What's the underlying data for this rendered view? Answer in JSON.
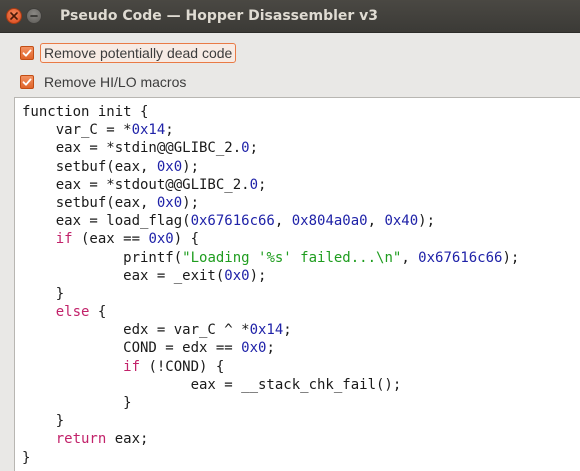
{
  "window": {
    "title": "Pseudo Code — Hopper Disassembler v3",
    "close_icon": "close-icon",
    "minimize_icon": "minimize-icon"
  },
  "options": [
    {
      "label": "Remove potentially dead code",
      "checked": true,
      "focused": true
    },
    {
      "label": "Remove HI/LO macros",
      "checked": true,
      "focused": false
    }
  ],
  "colors": {
    "accent": "#e0642a",
    "keyword": "#c2226a",
    "number": "#1f22a8",
    "string": "#1f9d1f",
    "titlebar": "#3c3b37"
  },
  "code": {
    "lines": [
      [
        {
          "t": "function init {",
          "c": "plain"
        }
      ],
      [
        {
          "t": "    var_C = *",
          "c": "plain"
        },
        {
          "t": "0x14",
          "c": "num"
        },
        {
          "t": ";",
          "c": "plain"
        }
      ],
      [
        {
          "t": "    eax = *stdin@@GLIBC_2.",
          "c": "plain"
        },
        {
          "t": "0",
          "c": "num"
        },
        {
          "t": ";",
          "c": "plain"
        }
      ],
      [
        {
          "t": "    setbuf(eax, ",
          "c": "plain"
        },
        {
          "t": "0x0",
          "c": "num"
        },
        {
          "t": ");",
          "c": "plain"
        }
      ],
      [
        {
          "t": "    eax = *stdout@@GLIBC_2.",
          "c": "plain"
        },
        {
          "t": "0",
          "c": "num"
        },
        {
          "t": ";",
          "c": "plain"
        }
      ],
      [
        {
          "t": "    setbuf(eax, ",
          "c": "plain"
        },
        {
          "t": "0x0",
          "c": "num"
        },
        {
          "t": ");",
          "c": "plain"
        }
      ],
      [
        {
          "t": "    eax = load_flag(",
          "c": "plain"
        },
        {
          "t": "0x67616c66",
          "c": "num"
        },
        {
          "t": ", ",
          "c": "plain"
        },
        {
          "t": "0x804a0a0",
          "c": "num"
        },
        {
          "t": ", ",
          "c": "plain"
        },
        {
          "t": "0x40",
          "c": "num"
        },
        {
          "t": ");",
          "c": "plain"
        }
      ],
      [
        {
          "t": "    ",
          "c": "plain"
        },
        {
          "t": "if",
          "c": "kw"
        },
        {
          "t": " (eax == ",
          "c": "plain"
        },
        {
          "t": "0x0",
          "c": "num"
        },
        {
          "t": ") {",
          "c": "plain"
        }
      ],
      [
        {
          "t": "            printf(",
          "c": "plain"
        },
        {
          "t": "\"Loading '%s' failed...\\n\"",
          "c": "str"
        },
        {
          "t": ", ",
          "c": "plain"
        },
        {
          "t": "0x67616c66",
          "c": "num"
        },
        {
          "t": ");",
          "c": "plain"
        }
      ],
      [
        {
          "t": "            eax = _exit(",
          "c": "plain"
        },
        {
          "t": "0x0",
          "c": "num"
        },
        {
          "t": ");",
          "c": "plain"
        }
      ],
      [
        {
          "t": "    }",
          "c": "plain"
        }
      ],
      [
        {
          "t": "    ",
          "c": "plain"
        },
        {
          "t": "else",
          "c": "kw"
        },
        {
          "t": " {",
          "c": "plain"
        }
      ],
      [
        {
          "t": "            edx = var_C ^ *",
          "c": "plain"
        },
        {
          "t": "0x14",
          "c": "num"
        },
        {
          "t": ";",
          "c": "plain"
        }
      ],
      [
        {
          "t": "            COND = edx == ",
          "c": "plain"
        },
        {
          "t": "0x0",
          "c": "num"
        },
        {
          "t": ";",
          "c": "plain"
        }
      ],
      [
        {
          "t": "            ",
          "c": "plain"
        },
        {
          "t": "if",
          "c": "kw"
        },
        {
          "t": " (!COND) {",
          "c": "plain"
        }
      ],
      [
        {
          "t": "                    eax = __stack_chk_fail();",
          "c": "plain"
        }
      ],
      [
        {
          "t": "            }",
          "c": "plain"
        }
      ],
      [
        {
          "t": "    }",
          "c": "plain"
        }
      ],
      [
        {
          "t": "    ",
          "c": "plain"
        },
        {
          "t": "return",
          "c": "kw"
        },
        {
          "t": " eax;",
          "c": "plain"
        }
      ],
      [
        {
          "t": "}",
          "c": "plain"
        }
      ]
    ]
  }
}
